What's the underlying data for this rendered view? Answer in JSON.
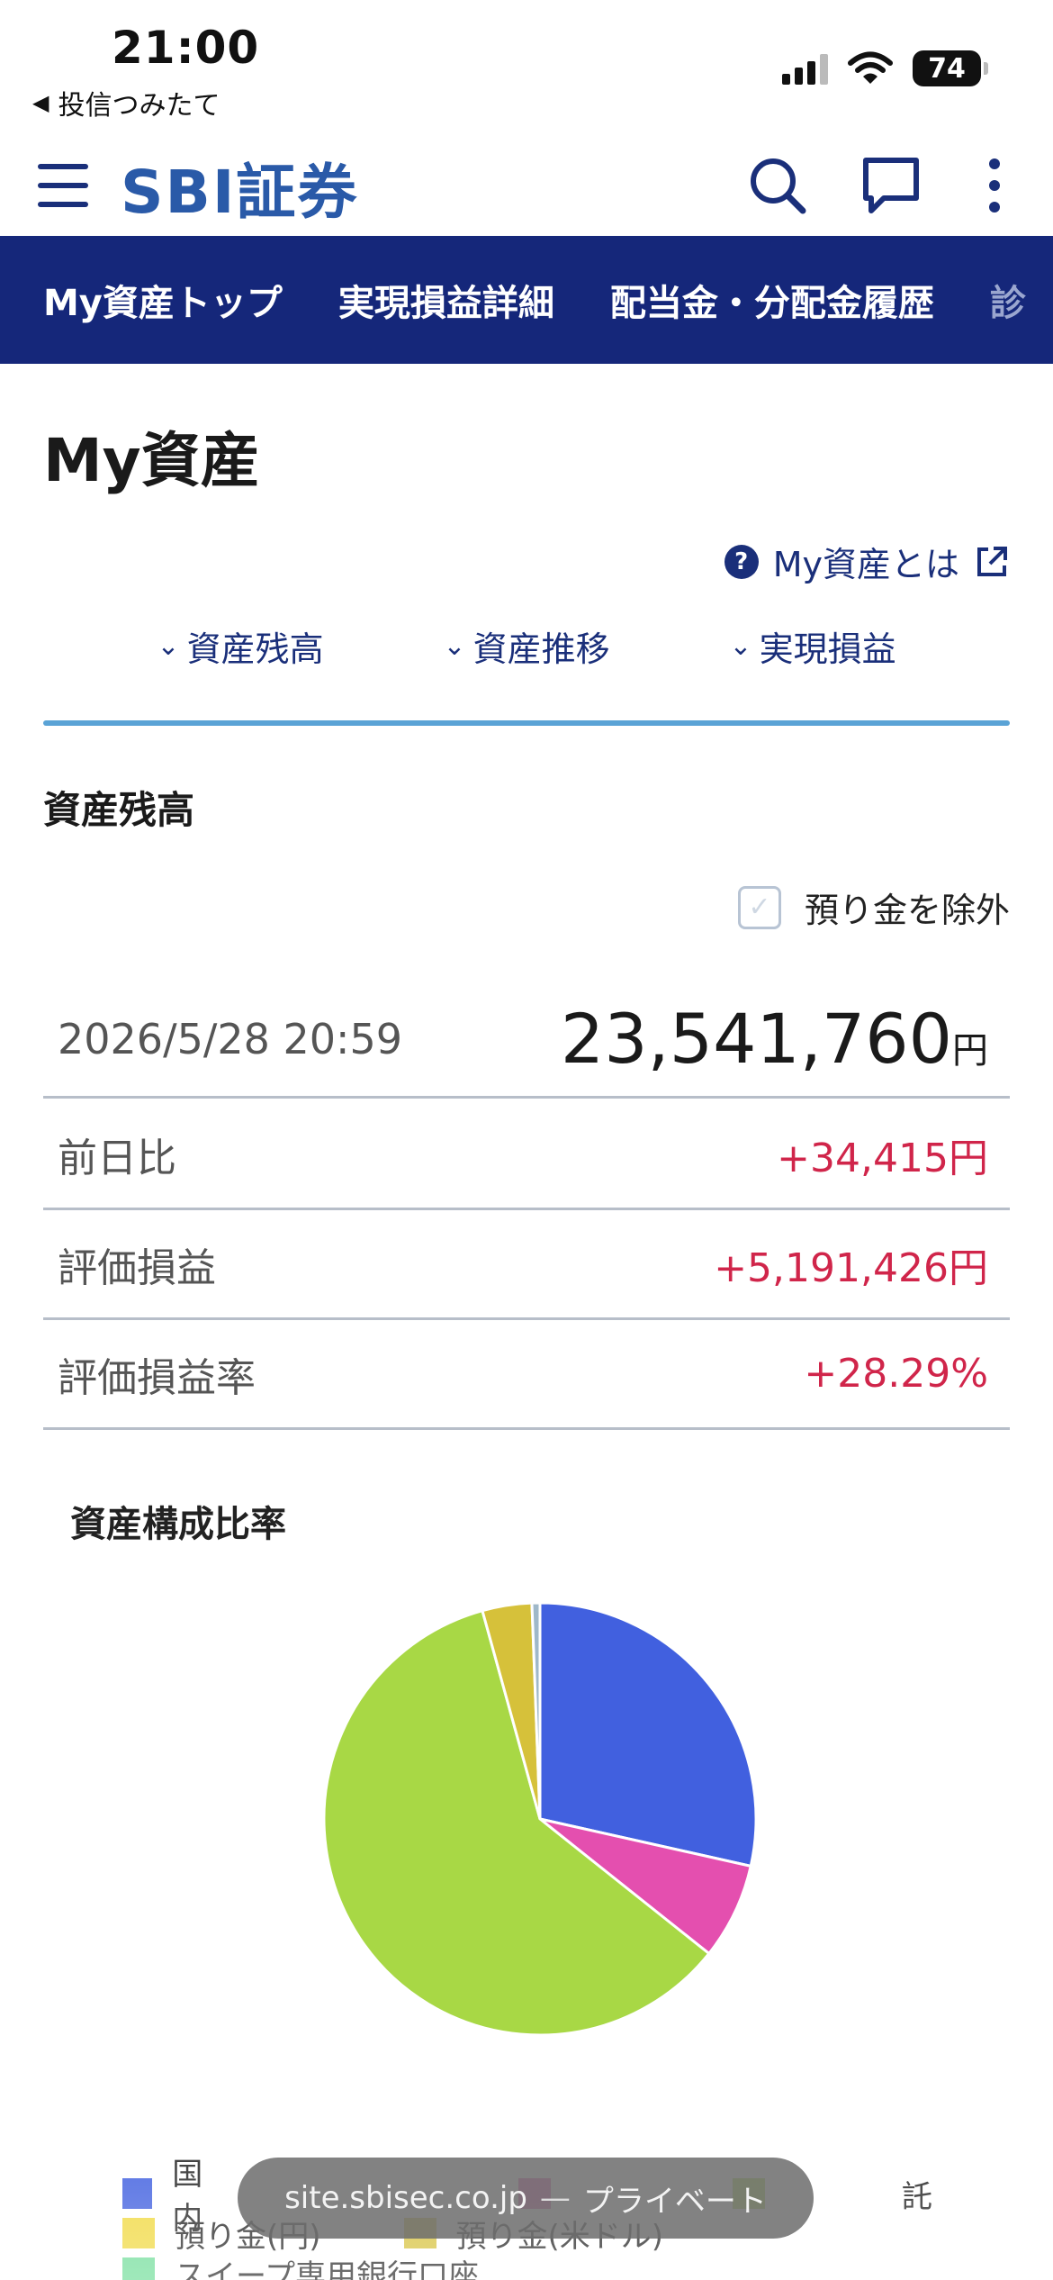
{
  "status_bar": {
    "time": "21:00",
    "back_app": "投信つみたて",
    "battery": "74"
  },
  "header": {
    "logo": "SBI証券",
    "icons": [
      "menu-icon",
      "search-icon",
      "chat-icon",
      "more-vertical-icon"
    ],
    "brand_color": "#1a2f7a"
  },
  "nav": {
    "tabs": [
      "My資産トップ",
      "実現損益詳細",
      "配当金・分配金履歴",
      "診"
    ],
    "bg_color": "#15277a"
  },
  "page": {
    "title": "My資産",
    "help_link": "My資産とは",
    "section_links": [
      "資産残高",
      "資産推移",
      "実現損益"
    ]
  },
  "balance": {
    "heading": "資産残高",
    "exclude_label": "預り金を除外",
    "exclude_checked": false,
    "datetime": "2026/5/28 20:59",
    "total": "23,541,760",
    "currency": "円",
    "rows": [
      {
        "label": "前日比",
        "value": "+34,415円"
      },
      {
        "label": "評価損益",
        "value": "+5,191,426円"
      },
      {
        "label": "評価損益率",
        "value": "+28.29%"
      }
    ],
    "positive_color": "#d0254a"
  },
  "chart_data": {
    "type": "pie",
    "title": "資産構成比率",
    "slices": [
      {
        "name": "国内",
        "percent": 28.5,
        "color": "#4160df"
      },
      {
        "name": "",
        "percent": 7.2,
        "color": "#e44faf"
      },
      {
        "name": "",
        "percent": 60.0,
        "color": "#a8d845"
      },
      {
        "name": "",
        "percent": 3.7,
        "color": "#d6c13a"
      },
      {
        "name": "",
        "percent": 0.6,
        "color": "#9fb8c9"
      }
    ],
    "legend": [
      [
        {
          "label": "国内",
          "color": "#4160df"
        },
        {
          "label": "",
          "color": "#e44faf"
        },
        {
          "label": "託",
          "color": "#a8d845"
        }
      ],
      [
        {
          "label": "預り金(円)",
          "color": "#f0d83c"
        },
        {
          "label": "預り金(米ドル)",
          "color": "#d6c13a"
        }
      ],
      [
        {
          "label": "スイープ専用銀行口座",
          "color": "#6cdc96"
        }
      ]
    ]
  },
  "browser": {
    "url": "site.sbisec.co.jp",
    "mode": "プライベート",
    "separator": "—"
  }
}
